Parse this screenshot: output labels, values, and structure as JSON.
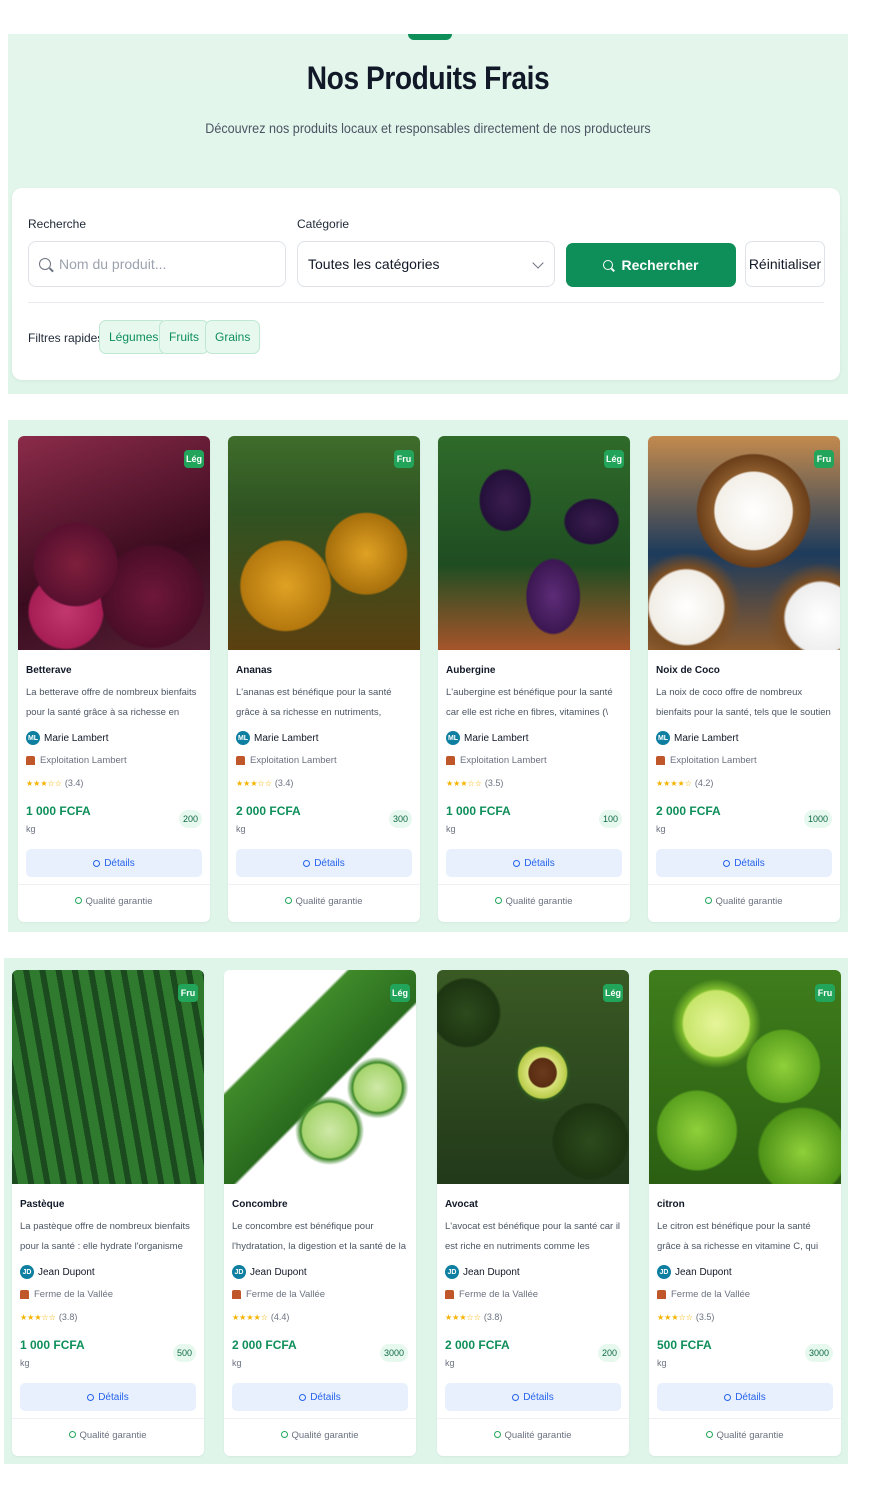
{
  "hero": {
    "title": "Nos Produits Frais",
    "subtitle": "Découvrez nos produits locaux et responsables directement de nos producteurs"
  },
  "search": {
    "label": "Recherche",
    "placeholder": "Nom du produit...",
    "category_label": "Catégorie",
    "category_value": "Toutes les catégories",
    "search_button": "Rechercher",
    "reset_button": "Réinitialiser",
    "quick_filters_label": "Filtres rapides :",
    "quick_filters": [
      "Légumes",
      "Fruits",
      "Grains"
    ]
  },
  "colors": {
    "accent": "#0e8f5a",
    "background_band": "#dff5e9",
    "details_button": "#e8f0fe",
    "badge": "#22a55b"
  },
  "card_labels": {
    "details": "Détails",
    "quality": "Qualité garantie",
    "unit": "kg"
  },
  "products": [
    {
      "name": "Betterave",
      "desc": "La betterave offre de nombreux bienfaits pour la santé grâce à sa richesse en nutriments. Elle...",
      "badge": "Lég",
      "seller": "Marie Lambert",
      "initials": "ML",
      "farm": "Exploitation Lambert",
      "stars": "★★★☆☆",
      "rating": "(3.4)",
      "price": "1 000 FCFA",
      "stock": "200",
      "image": "beetroot"
    },
    {
      "name": "Ananas",
      "desc": "L'ananas est bénéfique pour la santé grâce à sa richesse en nutriments, notamment la...",
      "badge": "Fru",
      "seller": "Marie Lambert",
      "initials": "ML",
      "farm": "Exploitation Lambert",
      "stars": "★★★☆☆",
      "rating": "(3.4)",
      "price": "2 000 FCFA",
      "stock": "300",
      "image": "pineapple"
    },
    {
      "name": "Aubergine",
      "desc": "L'aubergine est bénéfique pour la santé car elle est riche en fibres, vitamines (\\(B\\), \\(C\\), \\(E\\), \\...",
      "badge": "Lég",
      "seller": "Marie Lambert",
      "initials": "ML",
      "farm": "Exploitation Lambert",
      "stars": "★★★☆☆",
      "rating": "(3.5)",
      "price": "1 000 FCFA",
      "stock": "100",
      "image": "eggplant"
    },
    {
      "name": "Noix de Coco",
      "desc": "La noix de coco offre de nombreux bienfaits pour la santé, tels que le soutien de la digestio...",
      "badge": "Fru",
      "seller": "Marie Lambert",
      "initials": "ML",
      "farm": "Exploitation Lambert",
      "stars": "★★★★☆",
      "rating": "(4.2)",
      "price": "2 000 FCFA",
      "stock": "1000",
      "image": "coconut"
    },
    {
      "name": "Pastèque",
      "desc": "La pastèque offre de nombreux bienfaits pour la santé : elle hydrate l'organisme grâce à sa forte...",
      "badge": "Fru",
      "seller": "Jean Dupont",
      "initials": "JD",
      "farm": "Ferme de la Vallée",
      "stars": "★★★☆☆",
      "rating": "(3.8)",
      "price": "1 000 FCFA",
      "stock": "500",
      "image": "watermelon"
    },
    {
      "name": "Concombre",
      "desc": "Le concombre est bénéfique pour l'hydratation, la digestion et la santé de la peau, notamment...",
      "badge": "Lég",
      "seller": "Jean Dupont",
      "initials": "JD",
      "farm": "Ferme de la Vallée",
      "stars": "★★★★☆",
      "rating": "(4.4)",
      "price": "2 000 FCFA",
      "stock": "3000",
      "image": "cucumber"
    },
    {
      "name": "Avocat",
      "desc": "L'avocat est bénéfique pour la santé car il est riche en nutriments comme les graisses...",
      "badge": "Lég",
      "seller": "Jean Dupont",
      "initials": "JD",
      "farm": "Ferme de la Vallée",
      "stars": "★★★☆☆",
      "rating": "(3.8)",
      "price": "2 000 FCFA",
      "stock": "200",
      "image": "avocado"
    },
    {
      "name": "citron",
      "desc": "Le citron est bénéfique pour la santé grâce à sa richesse en vitamine C, qui renforce le système...",
      "badge": "Fru",
      "seller": "Jean Dupont",
      "initials": "JD",
      "farm": "Ferme de la Vallée",
      "stars": "★★★☆☆",
      "rating": "(3.5)",
      "price": "500 FCFA",
      "stock": "3000",
      "image": "lime"
    }
  ]
}
